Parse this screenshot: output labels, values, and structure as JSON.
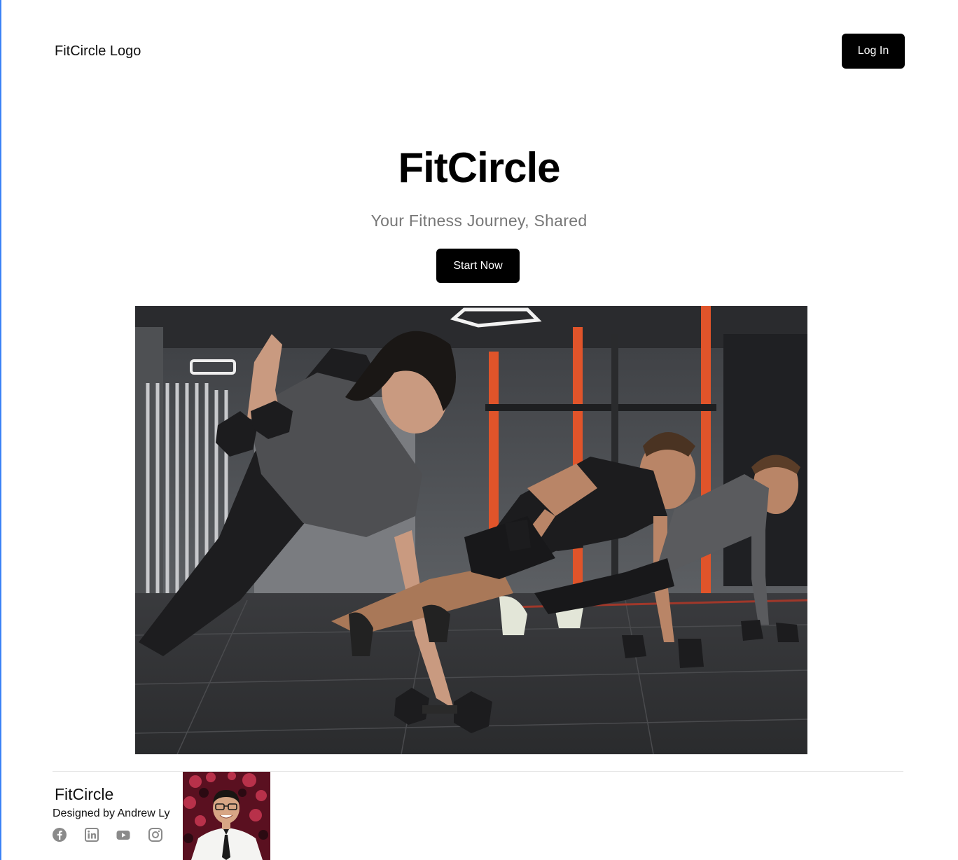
{
  "header": {
    "logo_text": "FitCircle Logo",
    "login_label": "Log In"
  },
  "hero": {
    "title": "FitCircle",
    "subtitle": "Your Fitness Journey, Shared",
    "cta_label": "Start Now"
  },
  "footer": {
    "title": "FitCircle",
    "credit": "Designed by Andrew Ly",
    "social_icons": [
      "facebook-icon",
      "linkedin-icon",
      "youtube-icon",
      "instagram-icon"
    ]
  },
  "colors": {
    "button_bg": "#000000",
    "button_text": "#ffffff",
    "subtitle_text": "#777777",
    "social_icon": "#8a8a8a",
    "gym_accent": "#e0542a"
  }
}
